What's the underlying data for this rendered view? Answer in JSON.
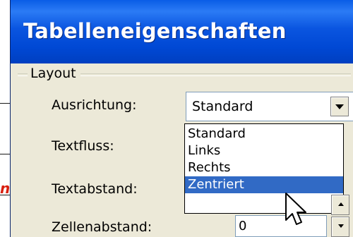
{
  "external": {
    "text_fragment": "n"
  },
  "window": {
    "title": "Tabelleneigenschaften"
  },
  "layout_group": {
    "label": "Layout",
    "ausrichtung": {
      "label": "Ausrichtung:",
      "value": "Standard",
      "options": [
        "Standard",
        "Links",
        "Rechts",
        "Zentriert"
      ],
      "highlighted": "Zentriert"
    },
    "textfluss": {
      "label": "Textfluss:"
    },
    "textabstand": {
      "label": "Textabstand:"
    },
    "zellenabstand": {
      "label": "Zellenabstand:",
      "value": "0"
    }
  },
  "colors": {
    "titlebar": "#0054e3",
    "selection": "#316ac5",
    "dialog": "#ece9d8",
    "external_text": "#d82010"
  }
}
